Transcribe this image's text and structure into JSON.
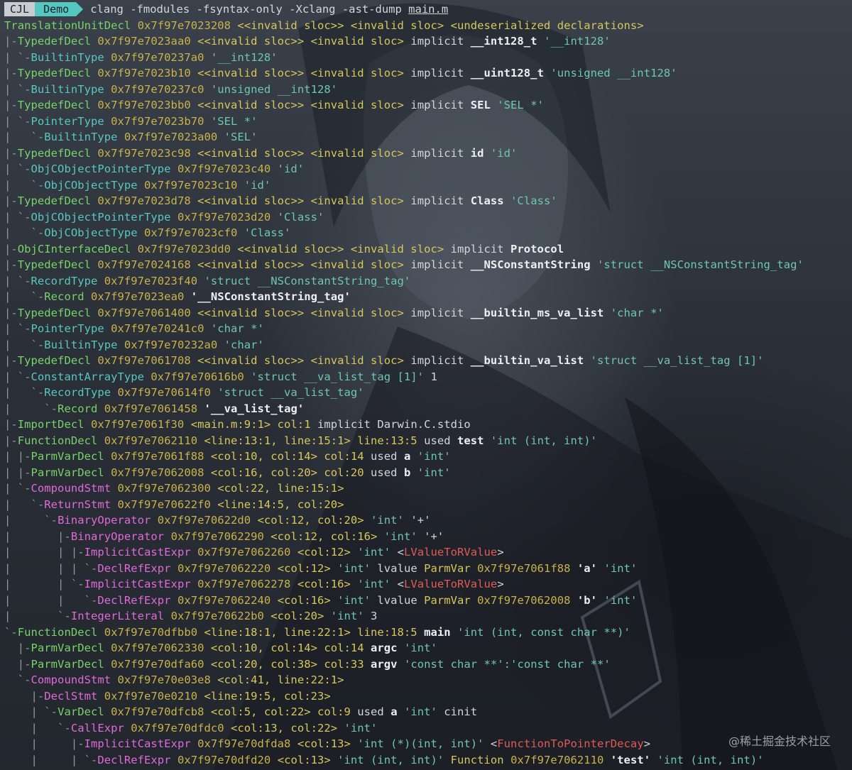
{
  "prompt": {
    "host": "CJL",
    "directory": "Demo",
    "command": "clang -fmodules -fsyntax-only -Xclang -ast-dump",
    "file": "main.m"
  },
  "colors": {
    "tree": "#8f98a0",
    "node-green": "#78d36a",
    "node-cyan": "#58c7c0",
    "node-magenta": "#e06ad8",
    "address": "#c9b34a",
    "location": "#d8c85a",
    "quote": "#6fc6b0",
    "cast": "#e15b56"
  },
  "watermark": "@稀土掘金技术社区",
  "lines": [
    [
      [
        "node-green",
        "TranslationUnitDecl "
      ],
      [
        "addr",
        "0x7f97e7023208 "
      ],
      [
        "loc",
        "<<invalid sloc>> <invalid sloc> <undeserialized declarations>"
      ]
    ],
    [
      [
        "tree",
        "|-"
      ],
      [
        "node-green",
        "TypedefDecl "
      ],
      [
        "addr",
        "0x7f97e7023aa0 "
      ],
      [
        "loc",
        "<<invalid sloc>> <invalid sloc> "
      ],
      [
        "plain",
        "implicit "
      ],
      [
        "bold",
        "__int128_t "
      ],
      [
        "quote",
        "'__int128'"
      ]
    ],
    [
      [
        "tree",
        "| `-"
      ],
      [
        "node-cyan",
        "BuiltinType "
      ],
      [
        "addr",
        "0x7f97e70237a0 "
      ],
      [
        "quote",
        "'__int128'"
      ]
    ],
    [
      [
        "tree",
        "|-"
      ],
      [
        "node-green",
        "TypedefDecl "
      ],
      [
        "addr",
        "0x7f97e7023b10 "
      ],
      [
        "loc",
        "<<invalid sloc>> <invalid sloc> "
      ],
      [
        "plain",
        "implicit "
      ],
      [
        "bold",
        "__uint128_t "
      ],
      [
        "quote",
        "'unsigned __int128'"
      ]
    ],
    [
      [
        "tree",
        "| `-"
      ],
      [
        "node-cyan",
        "BuiltinType "
      ],
      [
        "addr",
        "0x7f97e70237c0 "
      ],
      [
        "quote",
        "'unsigned __int128'"
      ]
    ],
    [
      [
        "tree",
        "|-"
      ],
      [
        "node-green",
        "TypedefDecl "
      ],
      [
        "addr",
        "0x7f97e7023bb0 "
      ],
      [
        "loc",
        "<<invalid sloc>> <invalid sloc> "
      ],
      [
        "plain",
        "implicit "
      ],
      [
        "bold",
        "SEL "
      ],
      [
        "quote",
        "'SEL *'"
      ]
    ],
    [
      [
        "tree",
        "| `-"
      ],
      [
        "node-cyan",
        "PointerType "
      ],
      [
        "addr",
        "0x7f97e7023b70 "
      ],
      [
        "quote",
        "'SEL *'"
      ]
    ],
    [
      [
        "tree",
        "|   `-"
      ],
      [
        "node-cyan",
        "BuiltinType "
      ],
      [
        "addr",
        "0x7f97e7023a00 "
      ],
      [
        "quote",
        "'SEL'"
      ]
    ],
    [
      [
        "tree",
        "|-"
      ],
      [
        "node-green",
        "TypedefDecl "
      ],
      [
        "addr",
        "0x7f97e7023c98 "
      ],
      [
        "loc",
        "<<invalid sloc>> <invalid sloc> "
      ],
      [
        "plain",
        "implicit "
      ],
      [
        "bold",
        "id "
      ],
      [
        "quote",
        "'id'"
      ]
    ],
    [
      [
        "tree",
        "| `-"
      ],
      [
        "node-cyan",
        "ObjCObjectPointerType "
      ],
      [
        "addr",
        "0x7f97e7023c40 "
      ],
      [
        "quote",
        "'id'"
      ]
    ],
    [
      [
        "tree",
        "|   `-"
      ],
      [
        "node-cyan",
        "ObjCObjectType "
      ],
      [
        "addr",
        "0x7f97e7023c10 "
      ],
      [
        "quote",
        "'id'"
      ]
    ],
    [
      [
        "tree",
        "|-"
      ],
      [
        "node-green",
        "TypedefDecl "
      ],
      [
        "addr",
        "0x7f97e7023d78 "
      ],
      [
        "loc",
        "<<invalid sloc>> <invalid sloc> "
      ],
      [
        "plain",
        "implicit "
      ],
      [
        "bold",
        "Class "
      ],
      [
        "quote",
        "'Class'"
      ]
    ],
    [
      [
        "tree",
        "| `-"
      ],
      [
        "node-cyan",
        "ObjCObjectPointerType "
      ],
      [
        "addr",
        "0x7f97e7023d20 "
      ],
      [
        "quote",
        "'Class'"
      ]
    ],
    [
      [
        "tree",
        "|   `-"
      ],
      [
        "node-cyan",
        "ObjCObjectType "
      ],
      [
        "addr",
        "0x7f97e7023cf0 "
      ],
      [
        "quote",
        "'Class'"
      ]
    ],
    [
      [
        "tree",
        "|-"
      ],
      [
        "node-green",
        "ObjCInterfaceDecl "
      ],
      [
        "addr",
        "0x7f97e7023dd0 "
      ],
      [
        "loc",
        "<<invalid sloc>> <invalid sloc> "
      ],
      [
        "plain",
        "implicit "
      ],
      [
        "bold",
        "Protocol"
      ]
    ],
    [
      [
        "tree",
        "|-"
      ],
      [
        "node-green",
        "TypedefDecl "
      ],
      [
        "addr",
        "0x7f97e7024168 "
      ],
      [
        "loc",
        "<<invalid sloc>> <invalid sloc> "
      ],
      [
        "plain",
        "implicit "
      ],
      [
        "bold",
        "__NSConstantString "
      ],
      [
        "quote",
        "'struct __NSConstantString_tag'"
      ]
    ],
    [
      [
        "tree",
        "| `-"
      ],
      [
        "node-cyan",
        "RecordType "
      ],
      [
        "addr",
        "0x7f97e7023f40 "
      ],
      [
        "quote",
        "'struct __NSConstantString_tag'"
      ]
    ],
    [
      [
        "tree",
        "|   `-"
      ],
      [
        "node-green",
        "Record "
      ],
      [
        "addr",
        "0x7f97e7023ea0 "
      ],
      [
        "bold",
        "'__NSConstantString_tag'"
      ]
    ],
    [
      [
        "tree",
        "|-"
      ],
      [
        "node-green",
        "TypedefDecl "
      ],
      [
        "addr",
        "0x7f97e7061400 "
      ],
      [
        "loc",
        "<<invalid sloc>> <invalid sloc> "
      ],
      [
        "plain",
        "implicit "
      ],
      [
        "bold",
        "__builtin_ms_va_list "
      ],
      [
        "quote",
        "'char *'"
      ]
    ],
    [
      [
        "tree",
        "| `-"
      ],
      [
        "node-cyan",
        "PointerType "
      ],
      [
        "addr",
        "0x7f97e70241c0 "
      ],
      [
        "quote",
        "'char *'"
      ]
    ],
    [
      [
        "tree",
        "|   `-"
      ],
      [
        "node-cyan",
        "BuiltinType "
      ],
      [
        "addr",
        "0x7f97e70232a0 "
      ],
      [
        "quote",
        "'char'"
      ]
    ],
    [
      [
        "tree",
        "|-"
      ],
      [
        "node-green",
        "TypedefDecl "
      ],
      [
        "addr",
        "0x7f97e7061708 "
      ],
      [
        "loc",
        "<<invalid sloc>> <invalid sloc> "
      ],
      [
        "plain",
        "implicit "
      ],
      [
        "bold",
        "__builtin_va_list "
      ],
      [
        "quote",
        "'struct __va_list_tag [1]'"
      ]
    ],
    [
      [
        "tree",
        "| `-"
      ],
      [
        "node-cyan",
        "ConstantArrayType "
      ],
      [
        "addr",
        "0x7f97e70616b0 "
      ],
      [
        "quote",
        "'struct __va_list_tag [1]' "
      ],
      [
        "plain",
        "1"
      ]
    ],
    [
      [
        "tree",
        "|   `-"
      ],
      [
        "node-cyan",
        "RecordType "
      ],
      [
        "addr",
        "0x7f97e70614f0 "
      ],
      [
        "quote",
        "'struct __va_list_tag'"
      ]
    ],
    [
      [
        "tree",
        "|     `-"
      ],
      [
        "node-green",
        "Record "
      ],
      [
        "addr",
        "0x7f97e7061458 "
      ],
      [
        "bold",
        "'__va_list_tag'"
      ]
    ],
    [
      [
        "tree",
        "|-"
      ],
      [
        "node-green",
        "ImportDecl "
      ],
      [
        "addr",
        "0x7f97e7061f30 "
      ],
      [
        "loc",
        "<main.m:9:1> col:1 "
      ],
      [
        "plain",
        "implicit Darwin.C.stdio"
      ]
    ],
    [
      [
        "tree",
        "|-"
      ],
      [
        "node-green",
        "FunctionDecl "
      ],
      [
        "addr",
        "0x7f97e7062110 "
      ],
      [
        "loc",
        "<line:13:1, line:15:1> line:13:5 "
      ],
      [
        "plain",
        "used "
      ],
      [
        "bold",
        "test "
      ],
      [
        "quote",
        "'int (int, int)'"
      ]
    ],
    [
      [
        "tree",
        "| |-"
      ],
      [
        "node-green",
        "ParmVarDecl "
      ],
      [
        "addr",
        "0x7f97e7061f88 "
      ],
      [
        "loc",
        "<col:10, col:14> col:14 "
      ],
      [
        "plain",
        "used "
      ],
      [
        "bold",
        "a "
      ],
      [
        "quote",
        "'int'"
      ]
    ],
    [
      [
        "tree",
        "| |-"
      ],
      [
        "node-green",
        "ParmVarDecl "
      ],
      [
        "addr",
        "0x7f97e7062008 "
      ],
      [
        "loc",
        "<col:16, col:20> col:20 "
      ],
      [
        "plain",
        "used "
      ],
      [
        "bold",
        "b "
      ],
      [
        "quote",
        "'int'"
      ]
    ],
    [
      [
        "tree",
        "| `-"
      ],
      [
        "node-magenta",
        "CompoundStmt "
      ],
      [
        "addr",
        "0x7f97e7062300 "
      ],
      [
        "loc",
        "<col:22, line:15:1>"
      ]
    ],
    [
      [
        "tree",
        "|   `-"
      ],
      [
        "node-magenta",
        "ReturnStmt "
      ],
      [
        "addr",
        "0x7f97e70622f0 "
      ],
      [
        "loc",
        "<line:14:5, col:20>"
      ]
    ],
    [
      [
        "tree",
        "|     `-"
      ],
      [
        "node-magenta",
        "BinaryOperator "
      ],
      [
        "addr",
        "0x7f97e70622d0 "
      ],
      [
        "loc",
        "<col:12, col:20> "
      ],
      [
        "quote",
        "'int' "
      ],
      [
        "plain",
        "'+'"
      ]
    ],
    [
      [
        "tree",
        "|       |-"
      ],
      [
        "node-magenta",
        "BinaryOperator "
      ],
      [
        "addr",
        "0x7f97e7062290 "
      ],
      [
        "loc",
        "<col:12, col:16> "
      ],
      [
        "quote",
        "'int' "
      ],
      [
        "plain",
        "'+'"
      ]
    ],
    [
      [
        "tree",
        "|       | |-"
      ],
      [
        "node-magenta",
        "ImplicitCastExpr "
      ],
      [
        "addr",
        "0x7f97e7062260 "
      ],
      [
        "loc",
        "<col:12> "
      ],
      [
        "quote",
        "'int' "
      ],
      [
        "plain",
        "<"
      ],
      [
        "cast",
        "LValueToRValue"
      ],
      [
        "plain",
        ">"
      ]
    ],
    [
      [
        "tree",
        "|       | | `-"
      ],
      [
        "node-magenta",
        "DeclRefExpr "
      ],
      [
        "addr",
        "0x7f97e7062220 "
      ],
      [
        "loc",
        "<col:12> "
      ],
      [
        "quote",
        "'int' "
      ],
      [
        "plain",
        "lvalue "
      ],
      [
        "loc",
        "ParmVar "
      ],
      [
        "addr",
        "0x7f97e7061f88 "
      ],
      [
        "bold",
        "'a' "
      ],
      [
        "quote",
        "'int'"
      ]
    ],
    [
      [
        "tree",
        "|       | `-"
      ],
      [
        "node-magenta",
        "ImplicitCastExpr "
      ],
      [
        "addr",
        "0x7f97e7062278 "
      ],
      [
        "loc",
        "<col:16> "
      ],
      [
        "quote",
        "'int' "
      ],
      [
        "plain",
        "<"
      ],
      [
        "cast",
        "LValueToRValue"
      ],
      [
        "plain",
        ">"
      ]
    ],
    [
      [
        "tree",
        "|       |   `-"
      ],
      [
        "node-magenta",
        "DeclRefExpr "
      ],
      [
        "addr",
        "0x7f97e7062240 "
      ],
      [
        "loc",
        "<col:16> "
      ],
      [
        "quote",
        "'int' "
      ],
      [
        "plain",
        "lvalue "
      ],
      [
        "loc",
        "ParmVar "
      ],
      [
        "addr",
        "0x7f97e7062008 "
      ],
      [
        "bold",
        "'b' "
      ],
      [
        "quote",
        "'int'"
      ]
    ],
    [
      [
        "tree",
        "|       `-"
      ],
      [
        "node-magenta",
        "IntegerLiteral "
      ],
      [
        "addr",
        "0x7f97e70622b0 "
      ],
      [
        "loc",
        "<col:20> "
      ],
      [
        "quote",
        "'int' "
      ],
      [
        "plain",
        "3"
      ]
    ],
    [
      [
        "tree",
        "`-"
      ],
      [
        "node-green",
        "FunctionDecl "
      ],
      [
        "addr",
        "0x7f97e70dfbb0 "
      ],
      [
        "loc",
        "<line:18:1, line:22:1> line:18:5 "
      ],
      [
        "bold",
        "main "
      ],
      [
        "quote",
        "'int (int, const char **)'"
      ]
    ],
    [
      [
        "tree",
        "  |-"
      ],
      [
        "node-green",
        "ParmVarDecl "
      ],
      [
        "addr",
        "0x7f97e7062330 "
      ],
      [
        "loc",
        "<col:10, col:14> col:14 "
      ],
      [
        "bold",
        "argc "
      ],
      [
        "quote",
        "'int'"
      ]
    ],
    [
      [
        "tree",
        "  |-"
      ],
      [
        "node-green",
        "ParmVarDecl "
      ],
      [
        "addr",
        "0x7f97e70dfa60 "
      ],
      [
        "loc",
        "<col:20, col:38> col:33 "
      ],
      [
        "bold",
        "argv "
      ],
      [
        "quote",
        "'const char **':'const char **'"
      ]
    ],
    [
      [
        "tree",
        "  `-"
      ],
      [
        "node-magenta",
        "CompoundStmt "
      ],
      [
        "addr",
        "0x7f97e70e03e8 "
      ],
      [
        "loc",
        "<col:41, line:22:1>"
      ]
    ],
    [
      [
        "tree",
        "    |-"
      ],
      [
        "node-magenta",
        "DeclStmt "
      ],
      [
        "addr",
        "0x7f97e70e0210 "
      ],
      [
        "loc",
        "<line:19:5, col:23>"
      ]
    ],
    [
      [
        "tree",
        "    | `-"
      ],
      [
        "node-green",
        "VarDecl "
      ],
      [
        "addr",
        "0x7f97e70dfcb8 "
      ],
      [
        "loc",
        "<col:5, col:22> col:9 "
      ],
      [
        "plain",
        "used "
      ],
      [
        "bold",
        "a "
      ],
      [
        "quote",
        "'int' "
      ],
      [
        "plain",
        "cinit"
      ]
    ],
    [
      [
        "tree",
        "    |   `-"
      ],
      [
        "node-magenta",
        "CallExpr "
      ],
      [
        "addr",
        "0x7f97e70dfdc0 "
      ],
      [
        "loc",
        "<col:13, col:22> "
      ],
      [
        "quote",
        "'int'"
      ]
    ],
    [
      [
        "tree",
        "    |     |-"
      ],
      [
        "node-magenta",
        "ImplicitCastExpr "
      ],
      [
        "addr",
        "0x7f97e70dfda8 "
      ],
      [
        "loc",
        "<col:13> "
      ],
      [
        "quote",
        "'int (*)(int, int)' "
      ],
      [
        "plain",
        "<"
      ],
      [
        "cast",
        "FunctionToPointerDecay"
      ],
      [
        "plain",
        ">"
      ]
    ],
    [
      [
        "tree",
        "    |     | `-"
      ],
      [
        "node-magenta",
        "DeclRefExpr "
      ],
      [
        "addr",
        "0x7f97e70dfd20 "
      ],
      [
        "loc",
        "<col:13> "
      ],
      [
        "quote",
        "'int (int, int)' "
      ],
      [
        "loc",
        "Function "
      ],
      [
        "addr",
        "0x7f97e7062110 "
      ],
      [
        "bold",
        "'test' "
      ],
      [
        "quote",
        "'int (int, int)'"
      ]
    ]
  ]
}
